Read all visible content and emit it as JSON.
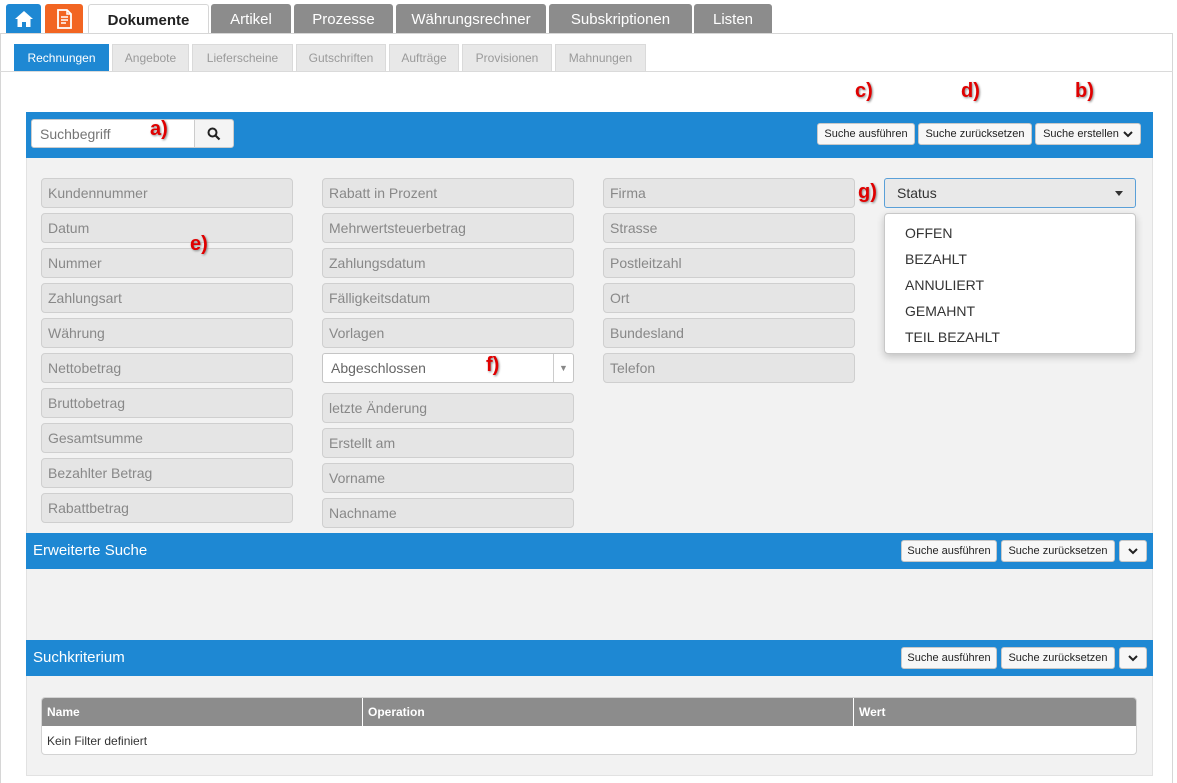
{
  "main_tabs": [
    {
      "label": "Dokumente",
      "active": true
    },
    {
      "label": "Artikel"
    },
    {
      "label": "Prozesse"
    },
    {
      "label": "Währungsrechner"
    },
    {
      "label": "Subskriptionen"
    },
    {
      "label": "Listen"
    }
  ],
  "sub_tabs": [
    {
      "label": "Rechnungen",
      "active": true
    },
    {
      "label": "Angebote"
    },
    {
      "label": "Lieferscheine"
    },
    {
      "label": "Gutschriften"
    },
    {
      "label": "Aufträge"
    },
    {
      "label": "Provisionen"
    },
    {
      "label": "Mahnungen"
    }
  ],
  "annotations": {
    "a": "a)",
    "b": "b)",
    "c": "c)",
    "d": "d)",
    "e": "e)",
    "f": "f)",
    "g": "g)"
  },
  "search": {
    "placeholder": "Suchbegriff",
    "run_label": "Suche ausführen",
    "reset_label": "Suche zurücksetzen",
    "create_label": "Suche erstellen"
  },
  "fields": {
    "col1": [
      "Kundennummer",
      "Datum",
      "Nummer",
      "Zahlungsart",
      "Währung",
      "Nettobetrag",
      "Bruttobetrag",
      "Gesamtsumme",
      "Bezahlter Betrag",
      "Rabattbetrag"
    ],
    "col2": [
      "Rabatt in Prozent",
      "Mehrwertsteuerbetrag",
      "Zahlungsdatum",
      "Fälligkeitsdatum",
      "Vorlagen",
      "letzte Änderung",
      "Erstellt am",
      "Vorname",
      "Nachname"
    ],
    "col3": [
      "Firma",
      "Strasse",
      "Postleitzahl",
      "Ort",
      "Bundesland",
      "Telefon"
    ]
  },
  "abgeschlossen_select": {
    "value": "Abgeschlossen"
  },
  "status_select": {
    "value": "Status",
    "options": [
      "OFFEN",
      "BEZAHLT",
      "ANNULIERT",
      "GEMAHNT",
      "TEIL BEZAHLT"
    ]
  },
  "erweiterte_suche": {
    "title": "Erweiterte Suche",
    "run_label": "Suche ausführen",
    "reset_label": "Suche zurücksetzen"
  },
  "suchkriterium": {
    "title": "Suchkriterium",
    "run_label": "Suche ausführen",
    "reset_label": "Suche zurücksetzen"
  },
  "criteria_table": {
    "headers": [
      "Name",
      "Operation",
      "Wert"
    ],
    "empty_text": "Kein Filter definiert"
  },
  "colors": {
    "accent": "#1e88d3",
    "home": "#1e88d3",
    "doc": "#f26522",
    "annotation": "#e00000"
  }
}
